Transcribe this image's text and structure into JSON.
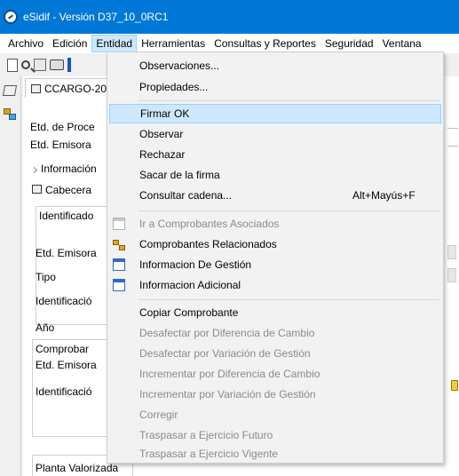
{
  "window": {
    "title": "eSidif - Versión D37_10_0RC1"
  },
  "menubar": {
    "items": [
      "Archivo",
      "Edición",
      "Entidad",
      "Herramientas",
      "Consultas y Reportes",
      "Seguridad",
      "Ventana"
    ],
    "active": "Entidad"
  },
  "toolbar": {
    "icons": [
      "new-document-icon",
      "search-icon",
      "save-icon",
      "print-icon"
    ]
  },
  "document": {
    "tab_title": "CCARGO-20",
    "labels": {
      "etd_proc": "Etd. de Proce",
      "etd_emisora": "Etd. Emisora",
      "informacion": "Información",
      "cabecera": "Cabecera",
      "identificado": "Identificado",
      "etd_emisora_2": "Etd. Emisora",
      "tipo": "Tipo",
      "identificacion": "Identificació",
      "anio": "Año",
      "comprobar": "Comprobar",
      "etd_emisora_3": "Etd. Emisora",
      "identificacion_2": "Identificació",
      "planta": "Planta Valorizada"
    }
  },
  "menu": {
    "items": [
      {
        "label": "Observaciones...",
        "enabled": true
      },
      {
        "label": "Propiedades...",
        "enabled": true
      },
      {
        "label": "Firmar OK",
        "enabled": true,
        "highlighted": true
      },
      {
        "label": "Observar",
        "enabled": true
      },
      {
        "label": "Rechazar",
        "enabled": true
      },
      {
        "label": "Sacar de la firma",
        "enabled": true
      },
      {
        "label": "Consultar cadena...",
        "enabled": true,
        "shortcut": "Alt+Mayús+F"
      },
      {
        "label": "Ir a Comprobantes Asociados",
        "enabled": false,
        "icon": "window-icon"
      },
      {
        "label": "Comprobantes Relacionados",
        "enabled": true,
        "icon": "related-docs-icon"
      },
      {
        "label": "Informacion De Gestión",
        "enabled": true,
        "icon": "window-icon"
      },
      {
        "label": "Informacion Adicional",
        "enabled": true,
        "icon": "window-icon"
      },
      {
        "label": "Copiar Comprobante",
        "enabled": true
      },
      {
        "label": "Desafectar por Diferencia de Cambio",
        "enabled": false
      },
      {
        "label": "Desafectar por Variación de Gestión",
        "enabled": false
      },
      {
        "label": "Incrementar por Diferencia de Cambio",
        "enabled": false
      },
      {
        "label": "Incrementar por Variación de Gestión",
        "enabled": false
      },
      {
        "label": "Corregir",
        "enabled": false
      },
      {
        "label": "Traspasar a Ejercicio Futuro",
        "enabled": false
      },
      {
        "label": "Traspasar a Ejercicio Vigente",
        "enabled": false
      }
    ]
  },
  "colors": {
    "titlebar": "#0078d7",
    "highlight": "#cce8ff",
    "highlight_border": "#99d1ff",
    "disabled_text": "#8a8a8a"
  }
}
